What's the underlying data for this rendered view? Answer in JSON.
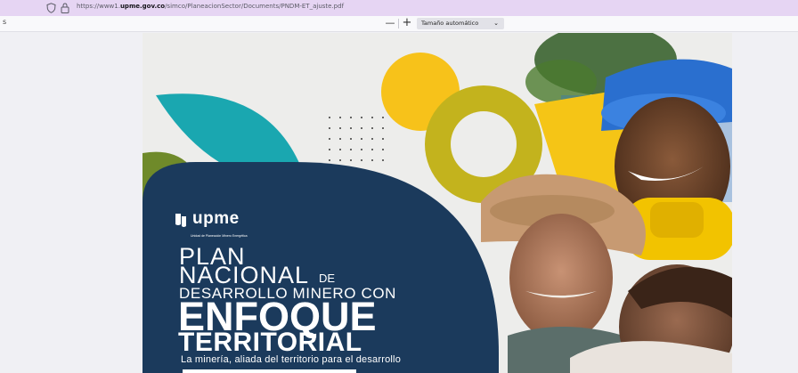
{
  "browser": {
    "url_prefix": "https://www1.",
    "url_domain": "upme.gov.co",
    "url_path": "/simco/PlaneacionSector/Documents/PNDM-ET_ajuste.pdf"
  },
  "pdf_toolbar": {
    "zoom_out": "—",
    "zoom_in": "+",
    "zoom_value": "Tamaño automático",
    "left_fragment": "s"
  },
  "cover": {
    "logo_text": "upme",
    "logo_subtitle": "Unidad de Planeación Minero Energética",
    "title_line1": "PLAN",
    "title_line2": "NACIONAL",
    "title_de": "DE",
    "title_line3": "DESARROLLO MINERO CON",
    "title_line4": "ENFOQUE",
    "title_line5": "TERRITORIAL",
    "tagline": "La minería, aliada del territorio para el desarrollo"
  },
  "colors": {
    "navy": "#1b3a5c",
    "teal": "#1aa7b0",
    "olive": "#c3b31d",
    "yellow": "#f7c21a",
    "green": "#6f8a2a",
    "tab_bar": "#e6d5f3"
  },
  "icons": {
    "shield": "tracking-protection-icon",
    "lock": "lock-icon",
    "chevron": "chevron-down-icon"
  }
}
